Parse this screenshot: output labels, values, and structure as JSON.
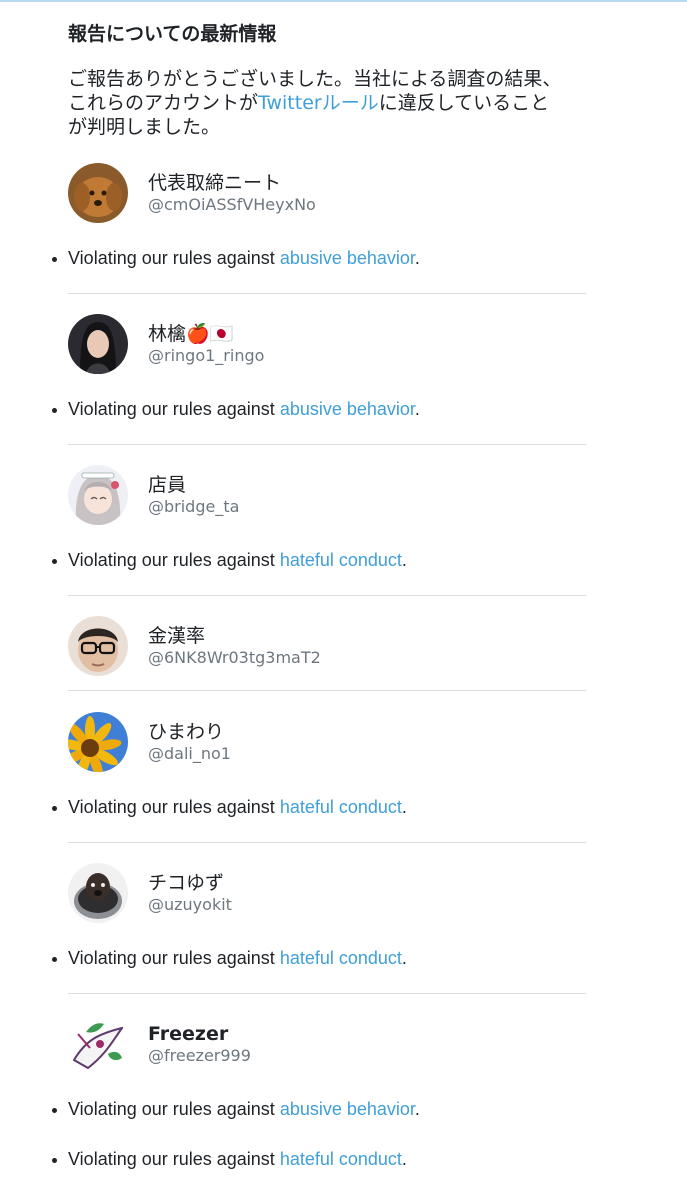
{
  "header": {
    "title": "報告についての最新情報",
    "intro_before": "ご報告ありがとうございました。当社による調査の結果、これらのアカウントが",
    "intro_link": "Twitterルール",
    "intro_after": "に違反していることが判明しました。"
  },
  "violation_prefix": "Violating our rules against ",
  "accounts": [
    {
      "display": "代表取締ニート",
      "handle": "@cmOiASSfVHeyxNo",
      "violations": [
        "abusive behavior"
      ]
    },
    {
      "display": "林檎🍎🇯🇵",
      "handle": "@ringo1_ringo",
      "violations": [
        "abusive behavior"
      ]
    },
    {
      "display": "店員",
      "handle": "@bridge_ta",
      "violations": [
        "hateful conduct"
      ]
    },
    {
      "display": "金漢率",
      "handle": "@6NK8Wr03tg3maT2",
      "violations": []
    },
    {
      "display": "ひまわり",
      "handle": "@dali_no1",
      "violations": [
        "hateful conduct"
      ]
    },
    {
      "display": "チコゆず",
      "handle": "@uzuyokit",
      "violations": [
        "hateful conduct"
      ]
    },
    {
      "display": "Freezer",
      "handle": "@freezer999",
      "violations": [
        "abusive behavior",
        "hateful conduct"
      ]
    }
  ],
  "punctuation": ".",
  "colors": {
    "link": "#3f9fd9",
    "text": "#1f2327",
    "secondary": "#6e7780",
    "divider": "#dcdfe2"
  }
}
